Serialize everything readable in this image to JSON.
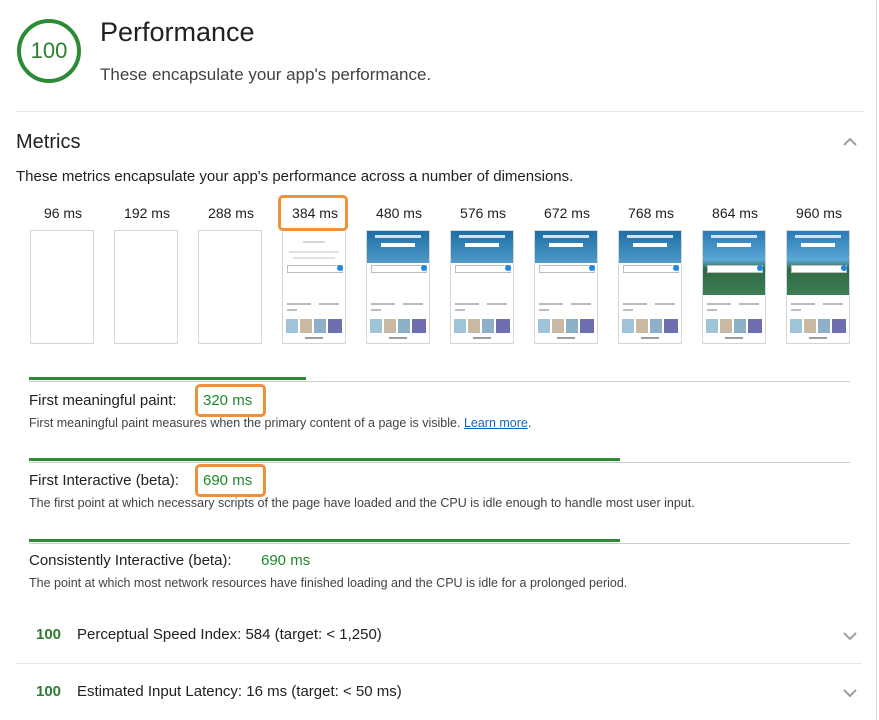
{
  "category": {
    "score": "100",
    "title": "Performance",
    "description": "These encapsulate your app's performance."
  },
  "metrics": {
    "title": "Metrics",
    "description": "These metrics encapsulate your app's performance across a number of dimensions.",
    "filmstrip": [
      "96 ms",
      "192 ms",
      "288 ms",
      "384 ms",
      "480 ms",
      "576 ms",
      "672 ms",
      "768 ms",
      "864 ms",
      "960 ms"
    ],
    "items": [
      {
        "label": "First meaningful paint:",
        "value": "320 ms",
        "help": "First meaningful paint measures when the primary content of a page is visible.",
        "link": "Learn more",
        "bar_fraction": 0.337
      },
      {
        "label": "First Interactive (beta):",
        "value": "690 ms",
        "help": "The first point at which necessary scripts of the page have loaded and the CPU is idle enough to handle most user input.",
        "bar_fraction": 0.72
      },
      {
        "label": "Consistently Interactive (beta):",
        "value": "690 ms",
        "help": "The point at which most network resources have finished loading and the CPU is idle for a prolonged period.",
        "bar_fraction": 0.72
      }
    ]
  },
  "audits": [
    {
      "score": "100",
      "label": "Perceptual Speed Index: 584 (target: < 1,250)"
    },
    {
      "score": "100",
      "label": "Estimated Input Latency: 16 ms (target: < 50 ms)"
    }
  ],
  "colors": {
    "pass": "#2e7d32",
    "highlight": "#f0913a",
    "link": "#1565c0"
  },
  "icons": {
    "collapse": "chevron-up-icon",
    "expand": "chevron-down-icon"
  }
}
